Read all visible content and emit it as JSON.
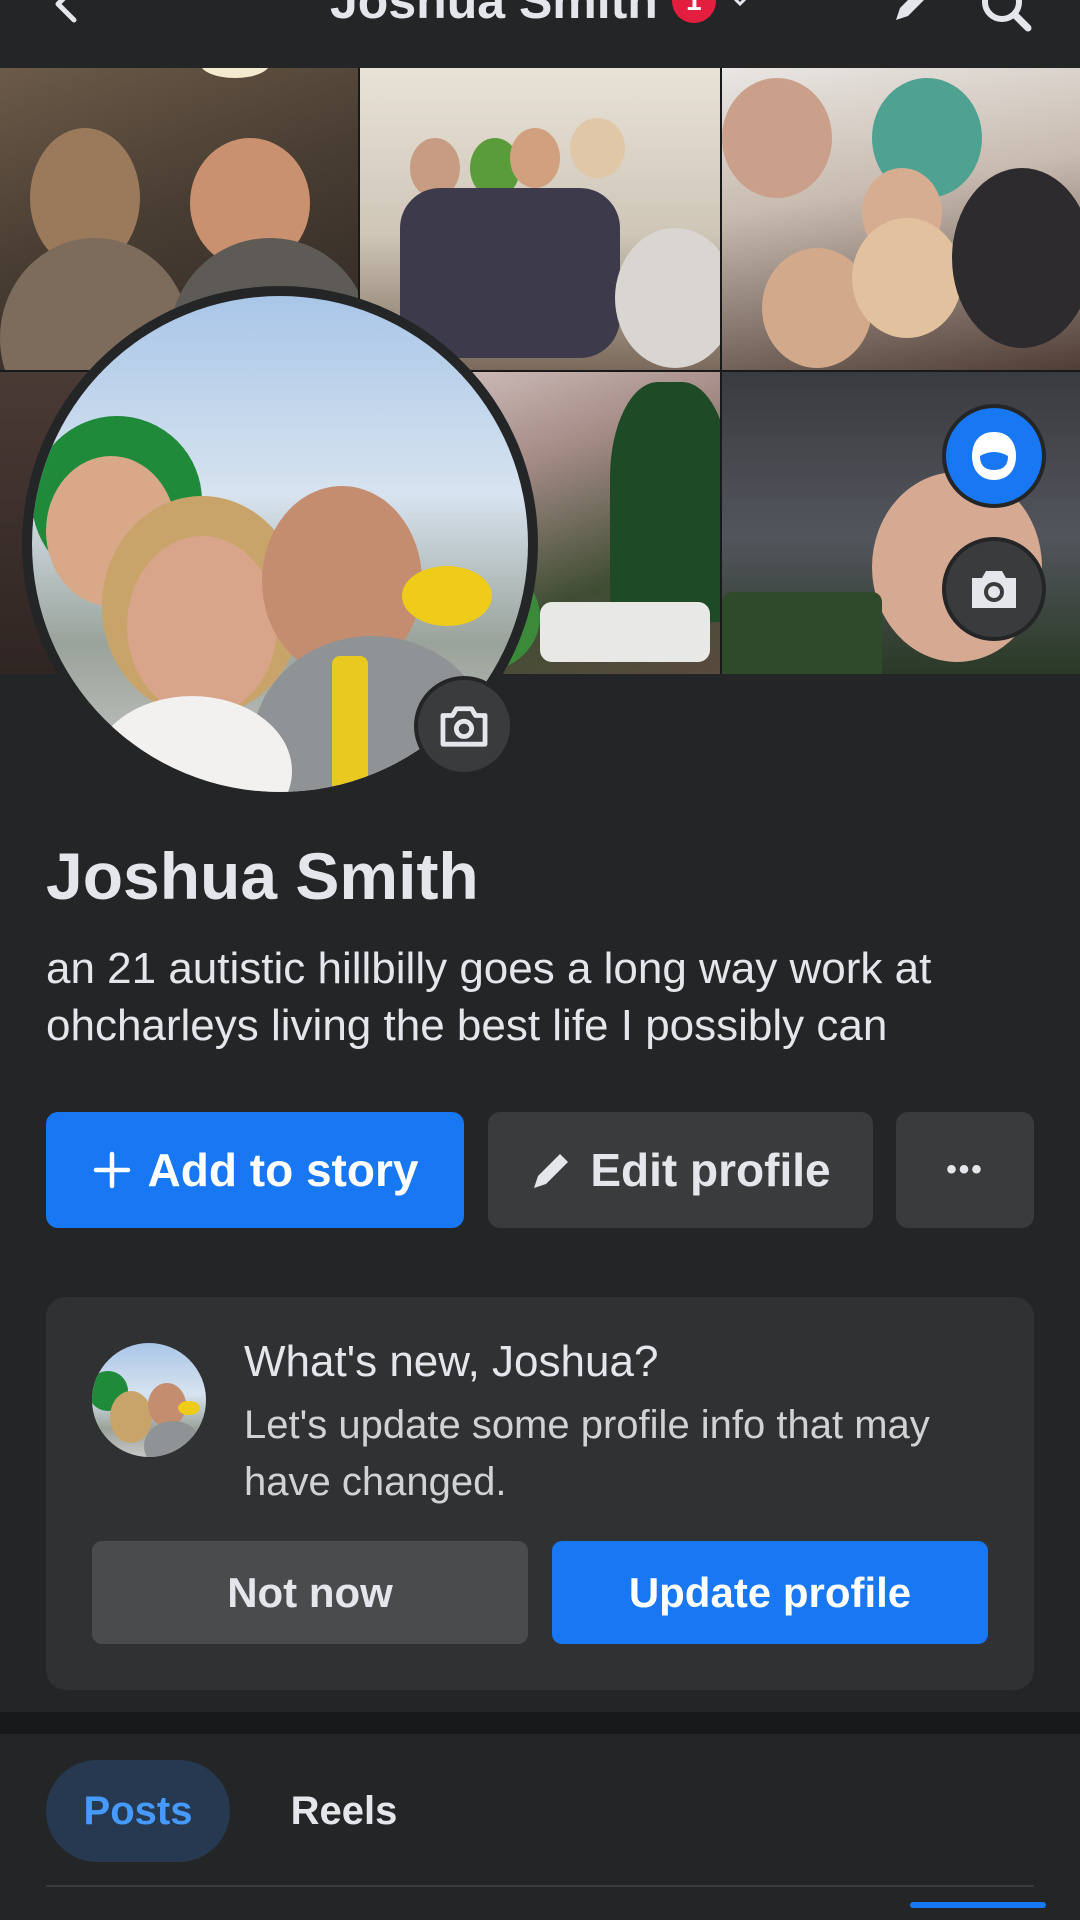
{
  "header": {
    "title": "Joshua Smith",
    "notification_count": "1",
    "icons": [
      "back-arrow-icon",
      "chevron-down-icon",
      "edit-pencil-icon",
      "search-icon"
    ]
  },
  "profile": {
    "name": "Joshua Smith",
    "bio": "an 21 autistic hillbilly goes a long way work at ohcharleys living the best life I possibly can"
  },
  "actions": {
    "add_story": "Add to story",
    "edit_profile": "Edit profile",
    "more": "•••"
  },
  "whats_new": {
    "title": "What's new, Joshua?",
    "description": "Let's update some profile info that may have changed.",
    "not_now": "Not now",
    "update_profile": "Update profile"
  },
  "tabs": [
    {
      "label": "Posts",
      "active": true
    },
    {
      "label": "Reels",
      "active": false
    }
  ],
  "colors": {
    "background": "#242526",
    "card": "#303133",
    "primary_blue": "#1877f2",
    "secondary_button": "#3a3b3c",
    "text": "#e4e6eb",
    "notification_red": "#e41e3f",
    "active_tab_bg": "#263951",
    "active_tab_text": "#4599ff"
  }
}
